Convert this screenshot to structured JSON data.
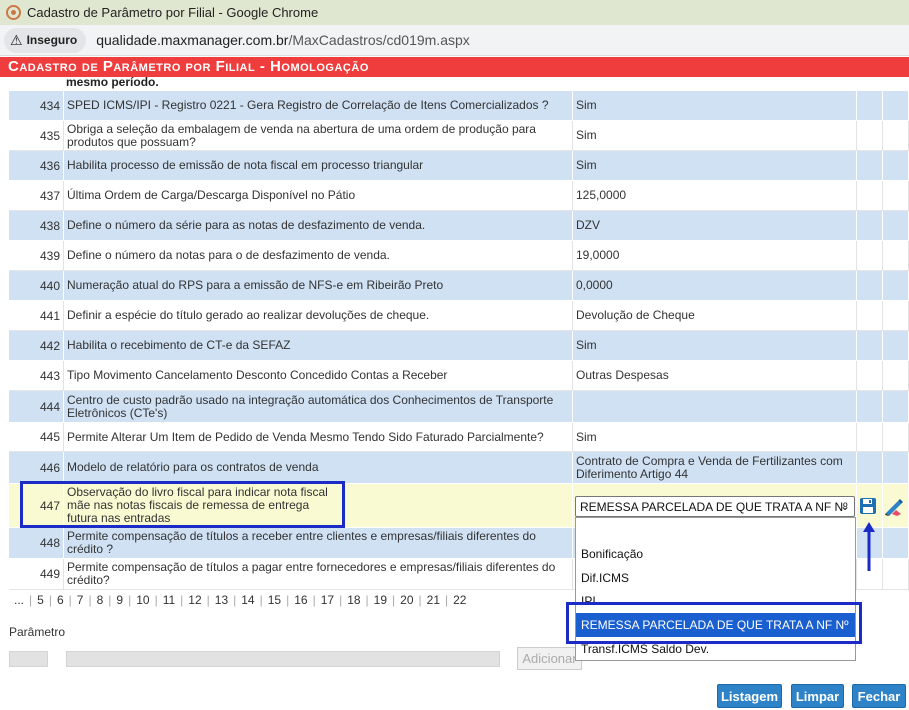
{
  "browser": {
    "window_title": "Cadastro de Parâmetro por Filial - Google Chrome",
    "security_label": "Inseguro",
    "url_host": "qualidade.maxmanager.com.br",
    "url_path": "/MaxCadastros/cd019m.aspx"
  },
  "page": {
    "header_title": "Cadastro de Parâmetro por Filial  - Homologação",
    "cut_row_text": "mesmo período."
  },
  "rows": [
    {
      "num": "434",
      "desc": "SPED ICMS/IPI - Registro 0221 - Gera Registro de Correlação de Itens Comercializados ?",
      "value": "Sim"
    },
    {
      "num": "435",
      "desc": "Obriga a seleção da embalagem de venda na abertura de uma ordem de produção para produtos que possuam?",
      "value": "Sim"
    },
    {
      "num": "436",
      "desc": "Habilita processo de emissão de nota fiscal em processo triangular",
      "value": "Sim"
    },
    {
      "num": "437",
      "desc": "Última Ordem de Carga/Descarga Disponível no Pátio",
      "value": "125,0000"
    },
    {
      "num": "438",
      "desc": "Define o número da série para as notas de desfazimento de venda.",
      "value": "DZV"
    },
    {
      "num": "439",
      "desc": "Define o número da notas para o de desfazimento de venda.",
      "value": "19,0000"
    },
    {
      "num": "440",
      "desc": "Numeração atual do RPS para a emissão de NFS-e em Ribeirão Preto",
      "value": "0,0000"
    },
    {
      "num": "441",
      "desc": "Definir a espécie do título gerado ao realizar devoluções de cheque.",
      "value": "Devolução de Cheque"
    },
    {
      "num": "442",
      "desc": "Habilita o recebimento de CT-e da SEFAZ",
      "value": "Sim"
    },
    {
      "num": "443",
      "desc": "Tipo Movimento Cancelamento Desconto Concedido Contas a Receber",
      "value": "Outras Despesas"
    },
    {
      "num": "444",
      "desc": "Centro de custo padrão usado na integração automática dos Conhecimentos de Transporte Eletrônicos (CTe's)",
      "value": ""
    },
    {
      "num": "445",
      "desc": "Permite Alterar Um Item de Pedido de Venda Mesmo Tendo Sido Faturado Parcialmente?",
      "value": "Sim"
    },
    {
      "num": "446",
      "desc": "Modelo de relatório para os contratos de venda",
      "value": "Contrato de Compra e Venda de Fertilizantes com Diferimento Artigo 44"
    },
    {
      "num": "447",
      "desc": "Observação do livro fiscal para indicar nota fiscal mãe nas notas fiscais de remessa de entrega futura nas entradas",
      "value": ""
    },
    {
      "num": "448",
      "desc": "Permite compensação de títulos a receber entre clientes e empresas/filiais diferentes do crédito ?",
      "value": ""
    },
    {
      "num": "449",
      "desc": "Permite compensação de títulos a pagar entre fornecedores e empresas/filiais diferentes do crédito?",
      "value": ""
    }
  ],
  "editing": {
    "selected_value": "REMESSA PARCELADA DE QUE TRATA A NF Nº",
    "options": [
      "",
      "Bonificação",
      "Dif.ICMS",
      "IPI",
      "REMESSA PARCELADA DE QUE TRATA A NF Nº",
      "Transf.ICMS Saldo Dev."
    ],
    "highlighted_option_index": 4,
    "save_icon": "floppy-disk-icon",
    "edit_icon": "pencil-eraser-icon"
  },
  "pager": {
    "pages": [
      "...",
      "5",
      "6",
      "7",
      "8",
      "9",
      "10",
      "11",
      "12",
      "13",
      "14",
      "15",
      "16",
      "17",
      "18",
      "19",
      "20",
      "21",
      "22"
    ]
  },
  "form": {
    "param_label": "Parâmetro",
    "add_button": "Adicionar"
  },
  "buttons": {
    "list": "Listagem",
    "clear": "Limpar",
    "close": "Fechar"
  },
  "colors": {
    "header_red": "#ef3c3c",
    "row_blue": "#cfe1f3",
    "row_yellow": "#f9f9d2",
    "button_blue": "#2e82c7",
    "highlight_box": "#1c2bc5",
    "option_selected": "#1a5fd0"
  }
}
